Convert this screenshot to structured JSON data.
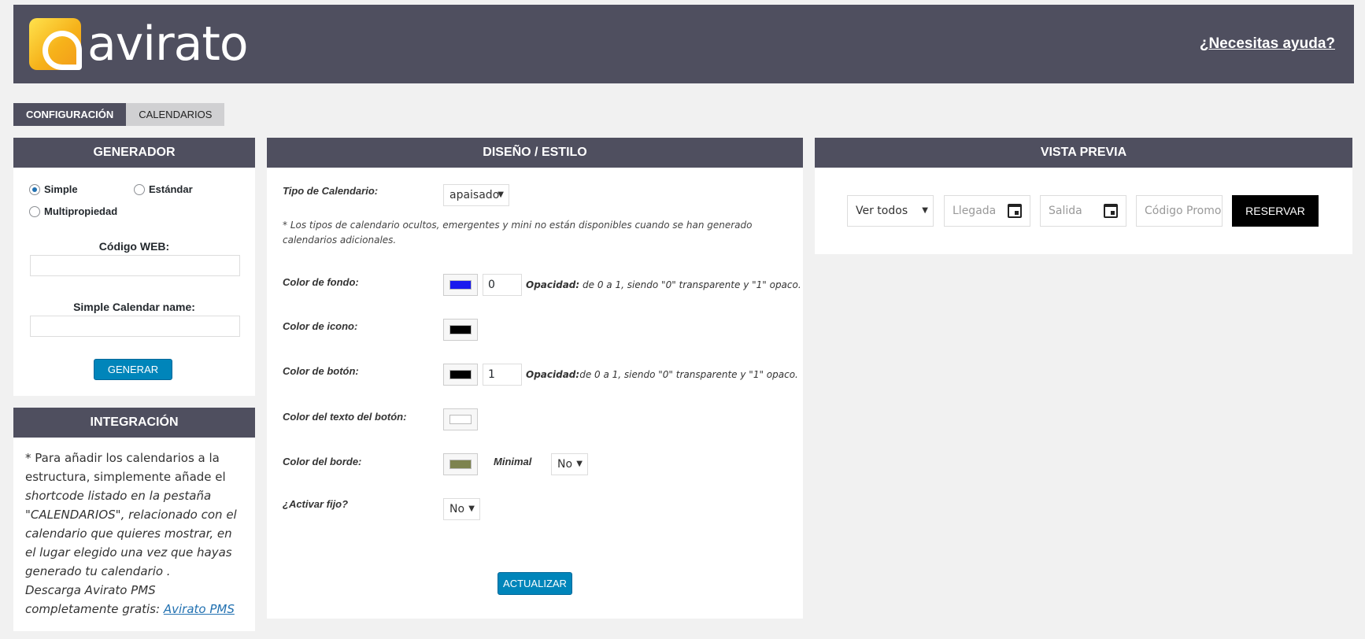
{
  "header": {
    "brand": "avirato",
    "help_link": "¿Necesitas ayuda?"
  },
  "tabs": [
    {
      "label": "CONFIGURACIÓN",
      "active": true
    },
    {
      "label": "CALENDARIOS",
      "active": false
    }
  ],
  "generador": {
    "title": "GENERADOR",
    "radios": [
      {
        "label": "Simple",
        "checked": true
      },
      {
        "label": "Estándar",
        "checked": false
      },
      {
        "label": "Multipropiedad",
        "checked": false
      }
    ],
    "codigo_web_label": "Código WEB:",
    "codigo_web_value": "",
    "calendar_name_label": "Simple Calendar name:",
    "calendar_name_value": "",
    "button": "GENERAR"
  },
  "integracion": {
    "title": "INTEGRACIÓN",
    "text_intro": "* Para añadir los calendarios a la estructura, simplemente añade el",
    "text_italic": "shortcode listado en la pestaña \"CALENDARIOS\", relacionado con el calendario que quieres mostrar, en el lugar elegido una vez que hayas generado tu calendario .",
    "download_text": "Descarga Avirato PMS completamente gratis:",
    "download_link": "Avirato PMS"
  },
  "diseno": {
    "title": "DISEÑO / ESTILO",
    "tipo_label": "Tipo de Calendario:",
    "tipo_value": "apaisado",
    "note": "* Los tipos de calendario ocultos, emergentes y mini no están disponibles cuando se han generado calendarios adicionales.",
    "fondo_label": "Color de fondo:",
    "fondo_color": "#1a1aee",
    "fondo_opacity": "0",
    "opacity_word": "Opacidad:",
    "fondo_hint": " de 0 a 1, siendo \"0\" transparente y \"1\" opaco.",
    "icono_label": "Color de icono:",
    "icono_color": "#000000",
    "boton_label": "Color de botón:",
    "boton_color": "#000000",
    "boton_opacity": "1",
    "boton_hint": "de 0 a 1, siendo \"0\" transparente y \"1\" opaco.",
    "texto_boton_label": "Color del texto del botón:",
    "texto_boton_color": "#ffffff",
    "borde_label": "Color del borde:",
    "borde_color": "#7d834f",
    "minimal_label": "Minimal",
    "minimal_value": "No",
    "fijo_label": "¿Activar fijo?",
    "fijo_value": "No",
    "button": "ACTUALIZAR"
  },
  "preview": {
    "title": "VISTA PREVIA",
    "select_value": "Ver todos",
    "llegada_placeholder": "Llegada",
    "salida_placeholder": "Salida",
    "promo_placeholder": "Código Promoc",
    "button": "RESERVAR"
  }
}
